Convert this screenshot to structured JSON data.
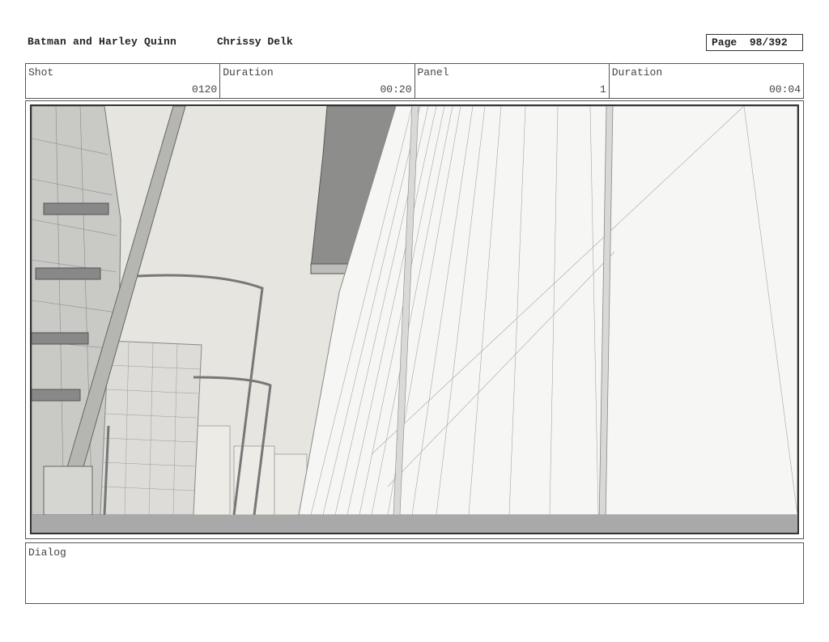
{
  "header": {
    "title": "Batman and Harley Quinn",
    "author": "Chrissy Delk",
    "page_label": "Page",
    "page_value": "98/392"
  },
  "info": {
    "shot_label": "Shot",
    "shot_value": "0120",
    "shot_duration_label": "Duration",
    "shot_duration_value": "00:20",
    "panel_label": "Panel",
    "panel_value": "1",
    "panel_duration_label": "Duration",
    "panel_duration_value": "00:04"
  },
  "dialog": {
    "label": "Dialog",
    "text": ""
  }
}
